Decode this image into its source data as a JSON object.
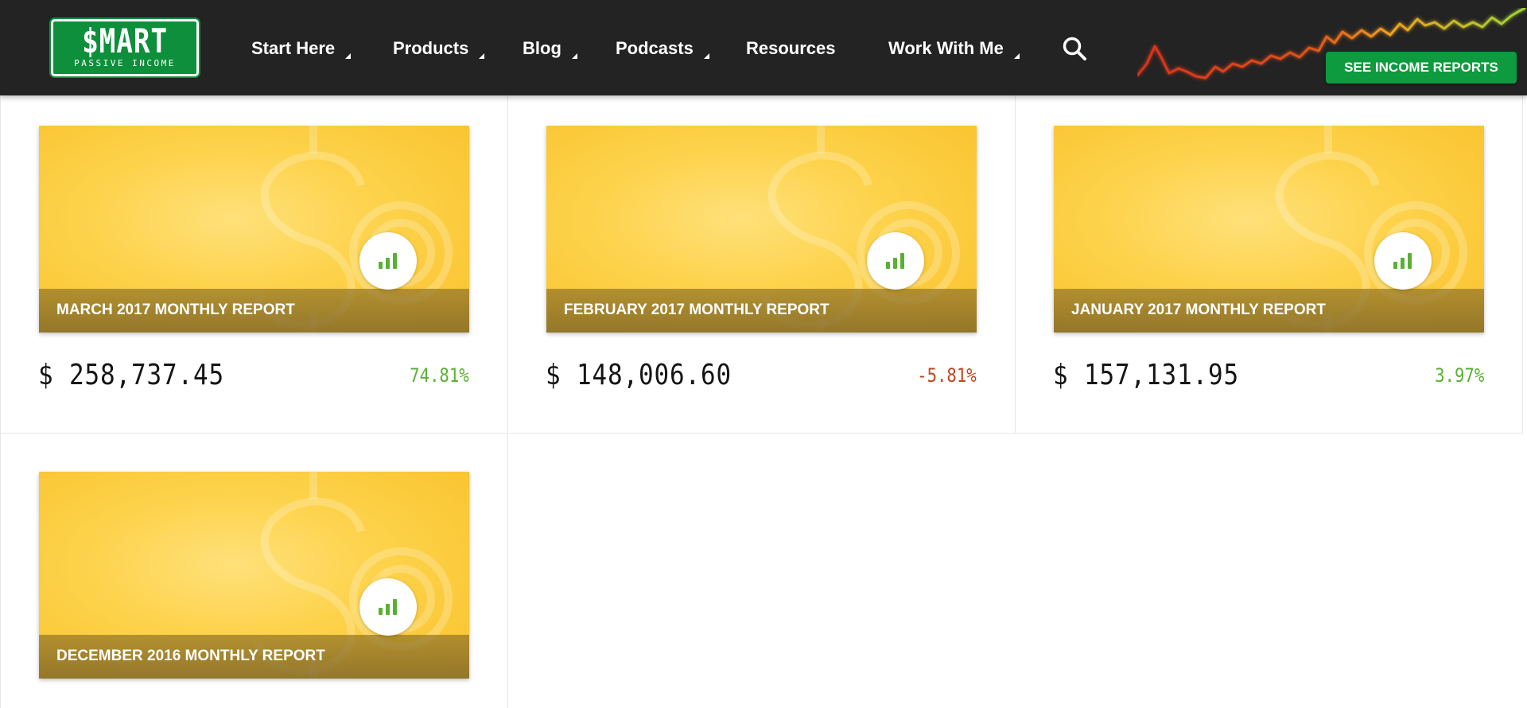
{
  "header": {
    "logo_main": "$MART",
    "logo_sub": "PASSIVE INCOME",
    "nav": [
      {
        "label": "Start Here",
        "has_caret": true
      },
      {
        "label": "Products",
        "has_caret": true
      },
      {
        "label": "Blog",
        "has_caret": true
      },
      {
        "label": "Podcasts",
        "has_caret": true
      },
      {
        "label": "Resources",
        "has_caret": false
      },
      {
        "label": "Work With Me",
        "has_caret": true
      }
    ],
    "search_icon": "search-icon",
    "cta_label": "SEE INCOME REPORTS"
  },
  "reports": [
    {
      "title": "MARCH 2017 MONTHLY REPORT",
      "amount": "$ 258,737.45",
      "change": "74.81%",
      "trend": "up"
    },
    {
      "title": "FEBRUARY 2017 MONTHLY REPORT",
      "amount": "$ 148,006.60",
      "change": "-5.81%",
      "trend": "down"
    },
    {
      "title": "JANUARY 2017 MONTHLY REPORT",
      "amount": "$ 157,131.95",
      "change": "3.97%",
      "trend": "up"
    },
    {
      "title": "DECEMBER 2016 MONTHLY REPORT",
      "amount": "",
      "change": "",
      "trend": ""
    }
  ],
  "colors": {
    "header_bg": "#232323",
    "brand_green": "#0e9a3e",
    "positive": "#5ab033",
    "negative": "#c0461e",
    "thumb_yellow": "#fdd24a"
  }
}
